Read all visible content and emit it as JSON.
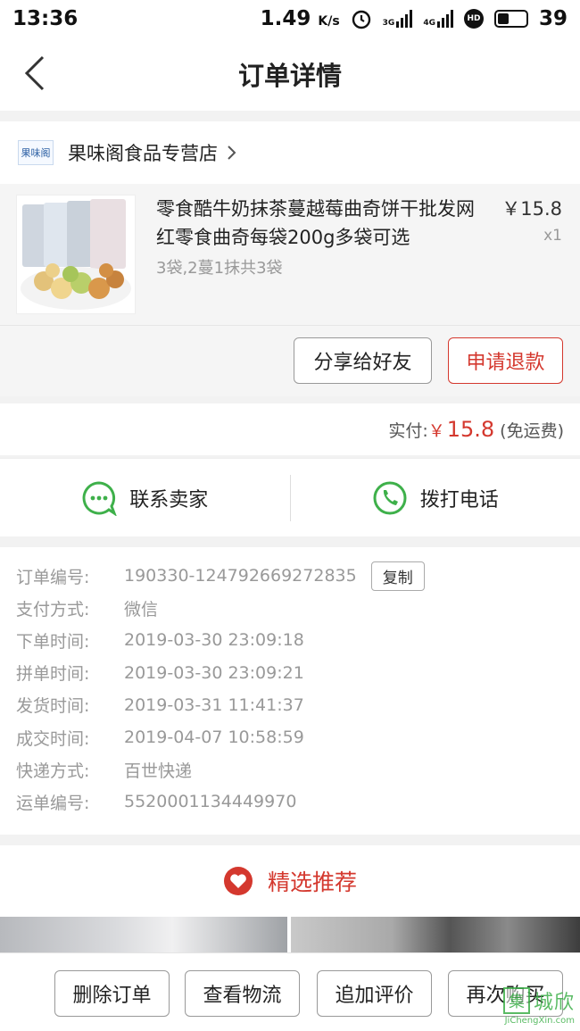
{
  "status_bar": {
    "time": "13:36",
    "speed": "1.49",
    "speed_unit": "K/s",
    "net1": "3G",
    "net2": "4G",
    "hd": "HD",
    "battery": "39",
    "battery_level": 0.39
  },
  "header": {
    "title": "订单详情"
  },
  "shop": {
    "logo_text": "果味阁",
    "name": "果味阁食品专营店"
  },
  "product": {
    "title": "零食酷牛奶抹茶蔓越莓曲奇饼干批发网红零食曲奇每袋200g多袋可选",
    "spec": "3袋,2蔓1抹共3袋",
    "price": "￥15.8",
    "qty": "x1"
  },
  "product_actions": {
    "share": "分享给好友",
    "refund": "申请退款"
  },
  "payment": {
    "label": "实付:",
    "currency": "￥",
    "amount": "15.8",
    "note": "(免运费)"
  },
  "contact": {
    "seller": "联系卖家",
    "call": "拨打电话"
  },
  "order_info": {
    "copy_label": "复制",
    "rows": [
      {
        "label": "订单编号:",
        "value": "190330-124792669272835"
      },
      {
        "label": "支付方式:",
        "value": "微信"
      },
      {
        "label": "下单时间:",
        "value": "2019-03-30 23:09:18"
      },
      {
        "label": "拼单时间:",
        "value": "2019-03-30 23:09:21"
      },
      {
        "label": "发货时间:",
        "value": "2019-03-31 11:41:37"
      },
      {
        "label": "成交时间:",
        "value": "2019-04-07 10:58:59"
      },
      {
        "label": "快递方式:",
        "value": "百世快递"
      },
      {
        "label": "运单编号:",
        "value": "5520001134449970"
      }
    ]
  },
  "recommend": {
    "label": "精选推荐"
  },
  "bottom_actions": {
    "delete": "删除订单",
    "logistics": "查看物流",
    "review": "追加评价",
    "rebuy": "再次购买"
  },
  "watermark": {
    "glyph": "集",
    "text": "城欣",
    "url": "JiChengXin.com"
  },
  "colors": {
    "accent": "#d4382e",
    "green": "#3eb04a"
  }
}
